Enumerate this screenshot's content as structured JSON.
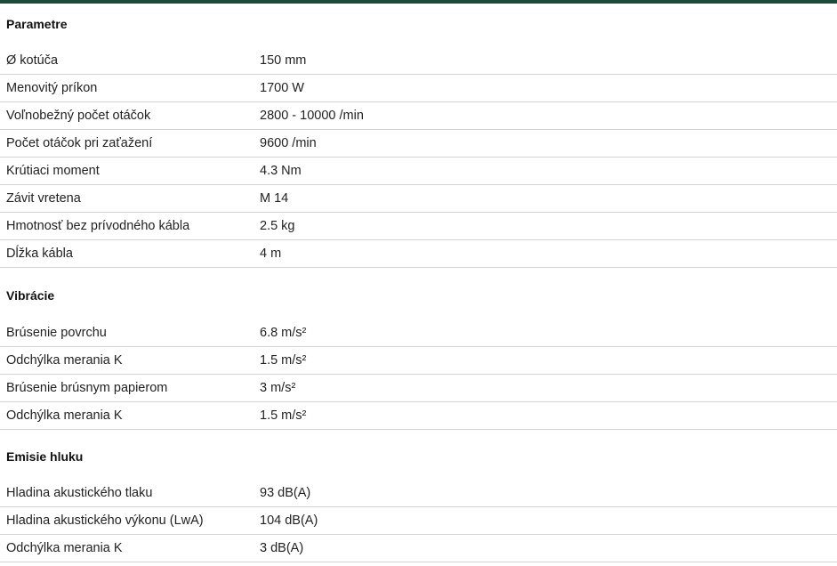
{
  "sections": [
    {
      "title": "Parametre",
      "rows": [
        {
          "label": "Ø kotúča",
          "value": "150 mm"
        },
        {
          "label": "Menovitý príkon",
          "value": "1700 W"
        },
        {
          "label": "Voľnobežný počet otáčok",
          "value": "2800 - 10000 /min"
        },
        {
          "label": "Počet otáčok pri zaťažení",
          "value": "9600 /min"
        },
        {
          "label": "Krútiaci moment",
          "value": "4.3 Nm"
        },
        {
          "label": "Závit vretena",
          "value": "M 14"
        },
        {
          "label": "Hmotnosť bez prívodného kábla",
          "value": "2.5 kg"
        },
        {
          "label": "Dĺžka kábla",
          "value": "4 m"
        }
      ]
    },
    {
      "title": "Vibrácie",
      "rows": [
        {
          "label": "Brúsenie povrchu",
          "value": "6.8 m/s²"
        },
        {
          "label": "Odchýlka merania K",
          "value": "1.5 m/s²"
        },
        {
          "label": "Brúsenie brúsnym papierom",
          "value": "3 m/s²"
        },
        {
          "label": "Odchýlka merania K",
          "value": "1.5 m/s²"
        }
      ]
    },
    {
      "title": "Emisie hluku",
      "rows": [
        {
          "label": "Hladina akustického tlaku",
          "value": "93 dB(A)"
        },
        {
          "label": "Hladina akustického výkonu (LwA)",
          "value": "104 dB(A)"
        },
        {
          "label": "Odchýlka merania K",
          "value": "3 dB(A)"
        }
      ]
    }
  ],
  "colors": {
    "accent_bar": "#1e4a3a",
    "divider": "#d3d3d3",
    "text": "#222222"
  }
}
